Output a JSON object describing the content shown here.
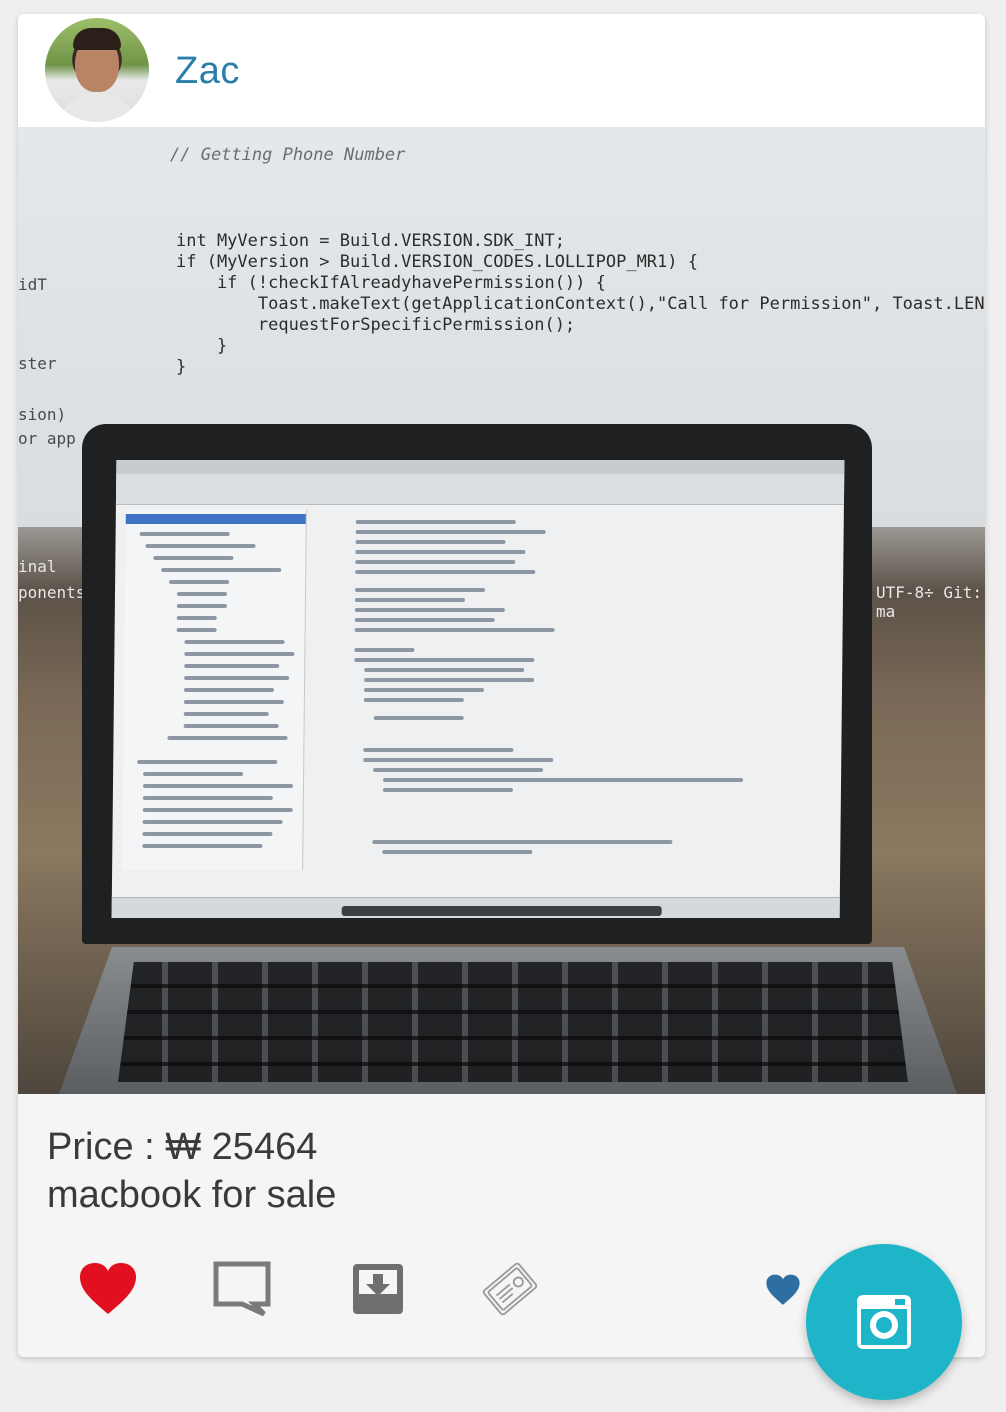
{
  "post": {
    "username": "Zac",
    "price_label": "Price : ₩ 25464",
    "title": "macbook for sale"
  },
  "photo": {
    "code_comment": "// Getting Phone Number",
    "code_lines": [
      "int MyVersion = Build.VERSION.SDK_INT;",
      "if (MyVersion > Build.VERSION_CODES.LOLLIPOP_MR1) {",
      "    if (!checkIfAlreadyhavePermission()) {",
      "        Toast.makeText(getApplicationContext(),\"Call for Permission\", Toast.LENGTH_SHO",
      "        requestForSpecificPermission();",
      "    }",
      "}"
    ],
    "edge_labels": [
      "idT",
      "ster",
      "sion)",
      "or app",
      "inal",
      "ponents"
    ],
    "right_status": "UTF-8÷  Git: ma"
  },
  "actions": {
    "like_icon": "heart-icon",
    "comment_icon": "comment-icon",
    "save_icon": "download-icon",
    "contact_icon": "contact-card-icon",
    "small_heart_icon": "heart-icon",
    "fab_icon": "camera-icon"
  },
  "colors": {
    "accent": "#1fb5c8",
    "username": "#2a7fa8",
    "like": "#e01020",
    "small_heart": "#2f6ea3"
  }
}
